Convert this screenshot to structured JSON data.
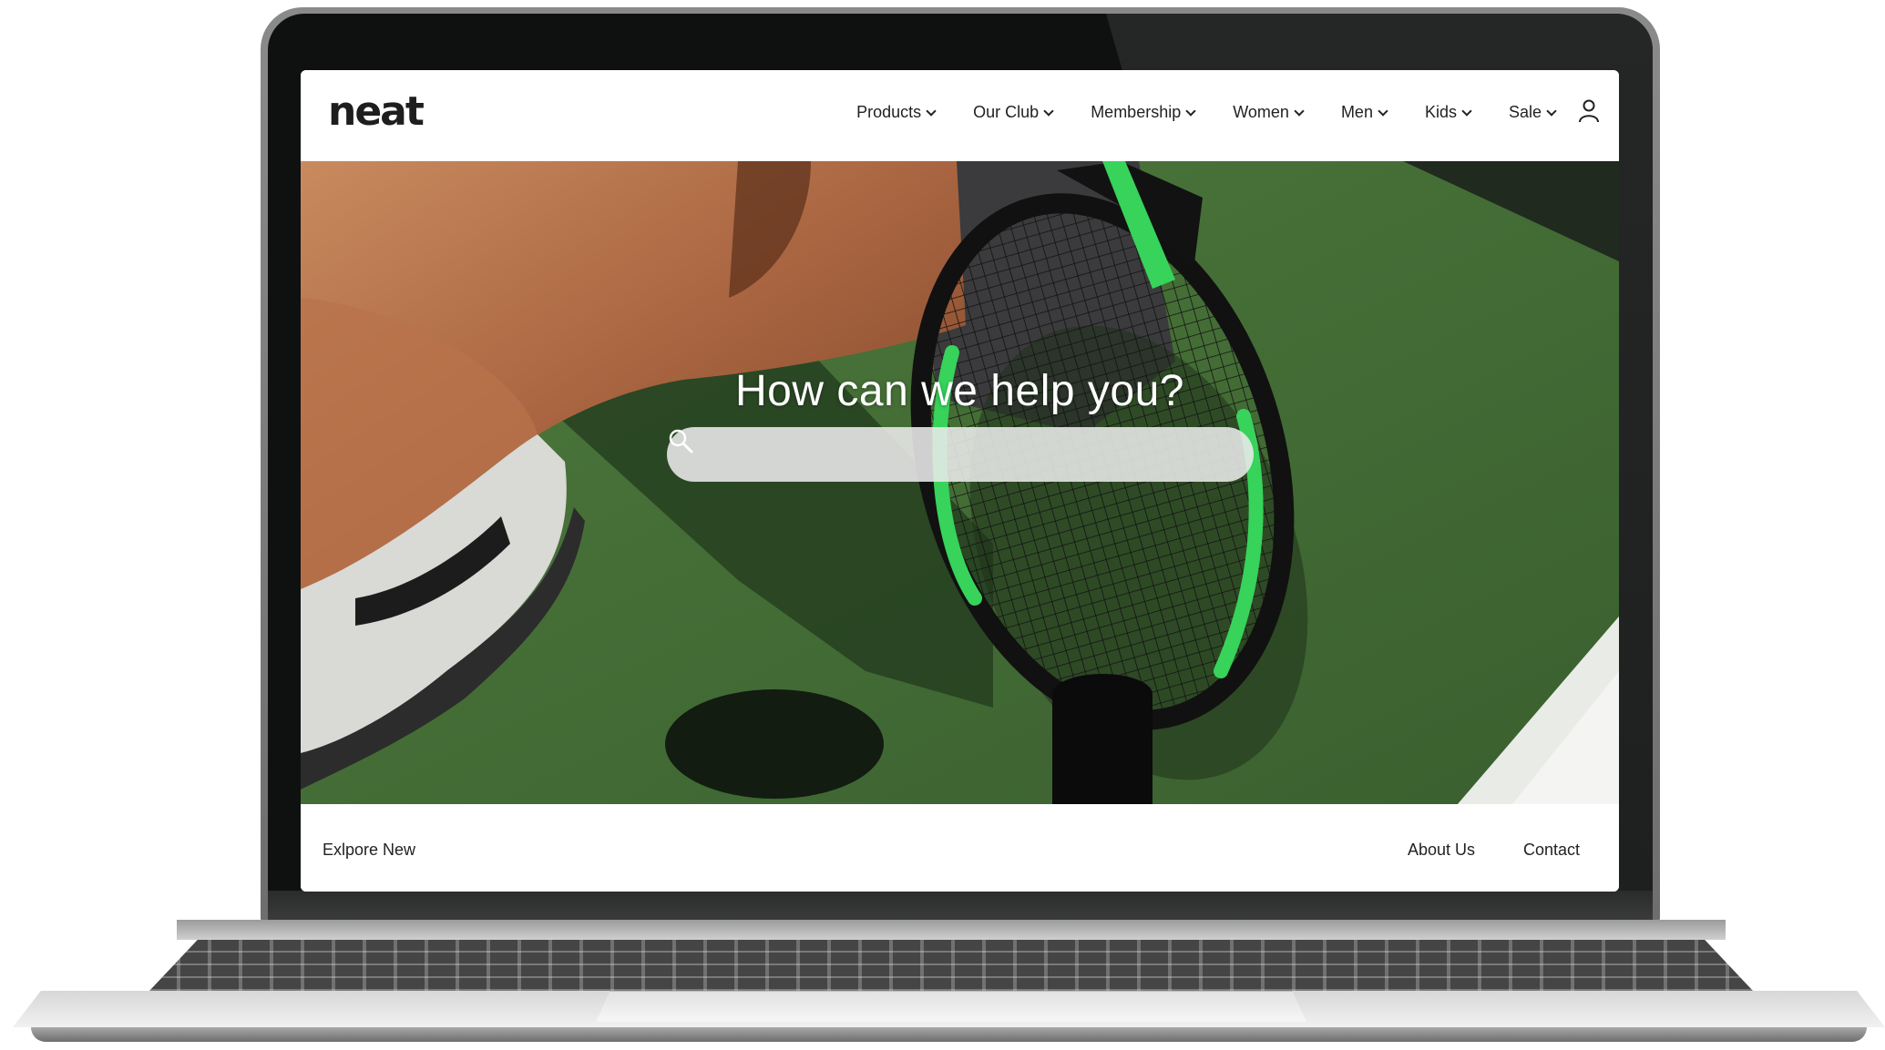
{
  "brand": {
    "logo_text": "neat"
  },
  "nav": {
    "items": [
      {
        "label": "Products"
      },
      {
        "label": "Our Club"
      },
      {
        "label": "Membership"
      },
      {
        "label": "Women"
      },
      {
        "label": "Men"
      },
      {
        "label": "Kids"
      },
      {
        "label": "Sale"
      }
    ],
    "account_icon": "user-icon"
  },
  "hero": {
    "title": "How can we help you?",
    "search": {
      "placeholder": "",
      "value": "",
      "icon": "search-icon"
    }
  },
  "footer": {
    "explore_label": "Exlpore New",
    "about_label": "About Us",
    "contact_label": "Contact"
  },
  "colors": {
    "court_green": "#3c6131",
    "racket_green": "#37d35a",
    "text_dark": "#222222",
    "laptop_bezel": "#0f1010"
  }
}
